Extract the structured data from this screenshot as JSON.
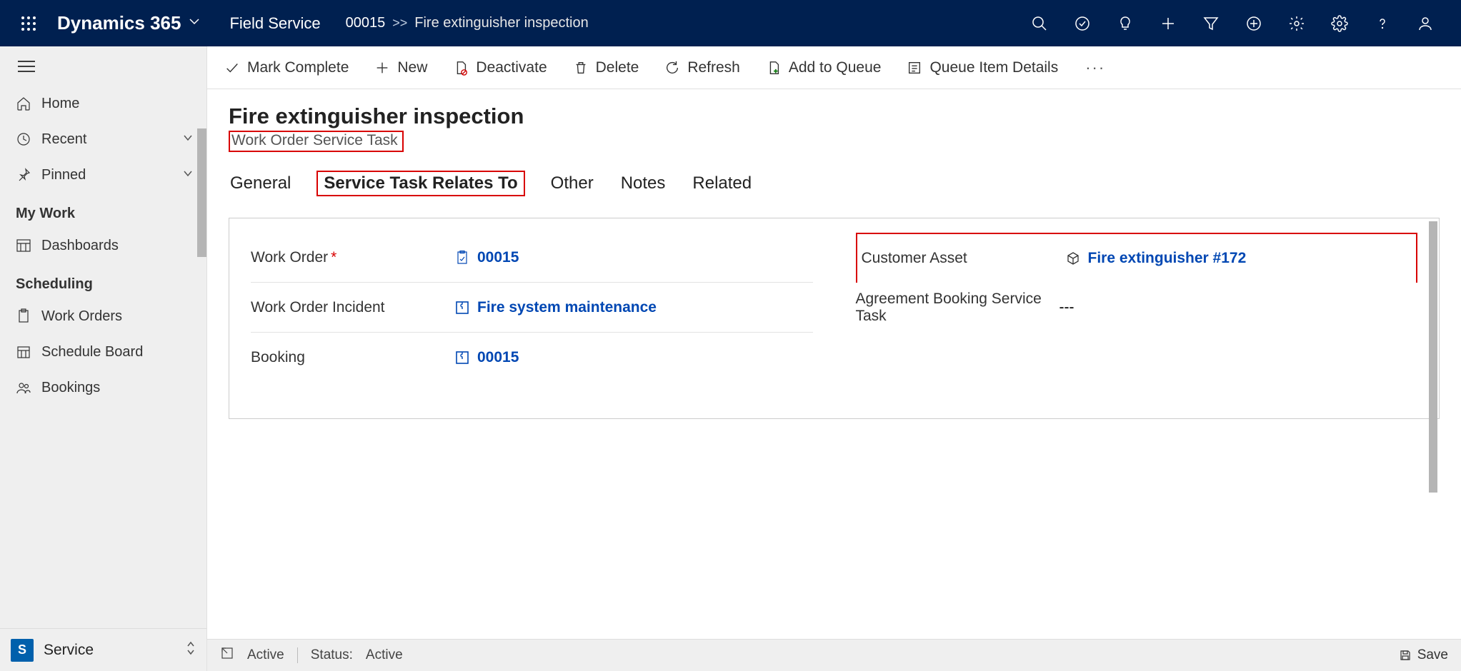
{
  "header": {
    "brand": "Dynamics 365",
    "module": "Field Service",
    "breadcrumb_id": "00015",
    "breadcrumb_title": "Fire extinguisher inspection"
  },
  "sidebar": {
    "home": "Home",
    "recent": "Recent",
    "pinned": "Pinned",
    "section_mywork": "My Work",
    "dashboards": "Dashboards",
    "section_scheduling": "Scheduling",
    "work_orders": "Work Orders",
    "schedule_board": "Schedule Board",
    "bookings": "Bookings",
    "area_badge": "S",
    "area_label": "Service"
  },
  "commands": {
    "mark_complete": "Mark Complete",
    "new": "New",
    "deactivate": "Deactivate",
    "delete": "Delete",
    "refresh": "Refresh",
    "add_to_queue": "Add to Queue",
    "queue_item_details": "Queue Item Details"
  },
  "record": {
    "title": "Fire extinguisher inspection",
    "entity": "Work Order Service Task"
  },
  "tabs": {
    "general": "General",
    "service_task_relates_to": "Service Task Relates To",
    "other": "Other",
    "notes": "Notes",
    "related": "Related"
  },
  "fields": {
    "work_order_label": "Work Order",
    "work_order_value": "00015",
    "work_order_incident_label": "Work Order Incident",
    "work_order_incident_value": "Fire system maintenance",
    "booking_label": "Booking",
    "booking_value": "00015",
    "customer_asset_label": "Customer Asset",
    "customer_asset_value": "Fire extinguisher #172",
    "agreement_booking_label": "Agreement Booking Service Task",
    "agreement_booking_value": "---"
  },
  "statusbar": {
    "state": "Active",
    "status_label": "Status:",
    "status_value": "Active",
    "save": "Save"
  }
}
